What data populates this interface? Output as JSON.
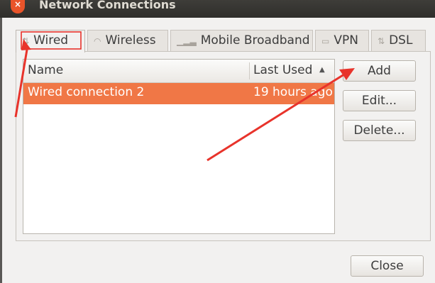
{
  "window": {
    "title": "Network Connections",
    "close_glyph": "×"
  },
  "tabs": [
    {
      "label": "Wired",
      "icon": "wired-icon",
      "glyph": "⇅"
    },
    {
      "label": "Wireless",
      "icon": "wifi-icon",
      "glyph": "◠"
    },
    {
      "label": "Mobile Broadband",
      "icon": "signal-icon",
      "glyph": "▁▂▃"
    },
    {
      "label": "VPN",
      "icon": "lock-icon",
      "glyph": "▭"
    },
    {
      "label": "DSL",
      "icon": "dsl-icon",
      "glyph": "⇅"
    }
  ],
  "table": {
    "columns": [
      "Name",
      "Last Used"
    ],
    "sort_glyph": "▲",
    "rows": [
      {
        "name": "Wired connection 2",
        "last_used": "19 hours ago"
      }
    ]
  },
  "buttons": {
    "add": "Add",
    "edit": "Edit...",
    "delete": "Delete...",
    "close": "Close"
  },
  "colors": {
    "selection": "#f07746",
    "annotation": "#e8332b",
    "close_button": "#e9542a"
  }
}
